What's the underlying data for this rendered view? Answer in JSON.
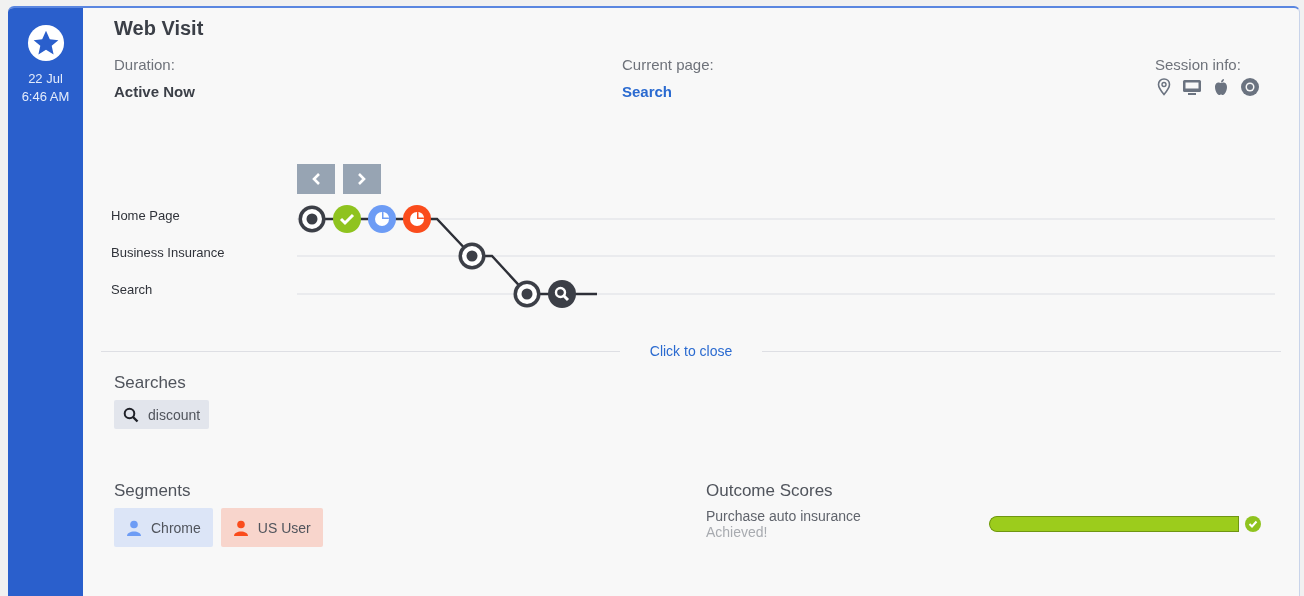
{
  "sidebar": {
    "date": "22 Jul",
    "time": "6:46 AM"
  },
  "visit": {
    "title": "Web Visit",
    "duration_label": "Duration:",
    "duration": "Active Now",
    "current_page_label": "Current page:",
    "current_page": "Search",
    "session_label": "Session info:"
  },
  "journey": {
    "lanes": [
      {
        "label": "Home Page",
        "nodes": [
          {
            "kind": "visit"
          },
          {
            "kind": "goal"
          },
          {
            "kind": "time",
            "color": "#6d9cf5"
          },
          {
            "kind": "time",
            "color": "#fa4c1c"
          }
        ]
      },
      {
        "label": "Business Insurance",
        "nodes": [
          {
            "kind": "visit"
          }
        ]
      },
      {
        "label": "Search",
        "nodes": [
          {
            "kind": "visit"
          },
          {
            "kind": "search"
          }
        ]
      }
    ]
  },
  "close_link": "Click to close",
  "searches": {
    "title": "Searches",
    "items": [
      "discount"
    ]
  },
  "segments": {
    "title": "Segments",
    "items": [
      {
        "label": "Chrome",
        "color": "#6d9cf5"
      },
      {
        "label": "US User",
        "color": "#fa4c1c"
      }
    ]
  },
  "outcomes": {
    "title": "Outcome Scores",
    "items": [
      {
        "name": "Purchase auto insurance",
        "status": "Achieved!",
        "level": 1,
        "achieved": true
      }
    ]
  }
}
